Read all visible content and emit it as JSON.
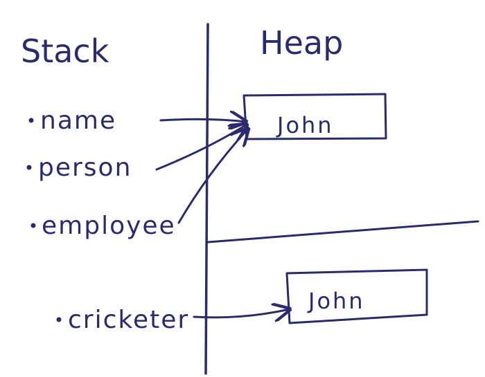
{
  "titles": {
    "stack": "Stack",
    "heap": "Heap"
  },
  "stack_items": [
    {
      "label": "name"
    },
    {
      "label": "person"
    },
    {
      "label": "employee"
    },
    {
      "label": "cricketer"
    }
  ],
  "heap_objects": [
    {
      "value": "John"
    },
    {
      "value": "John"
    }
  ],
  "colors": {
    "ink": "#2a2a6e",
    "background": "#ffffff"
  }
}
